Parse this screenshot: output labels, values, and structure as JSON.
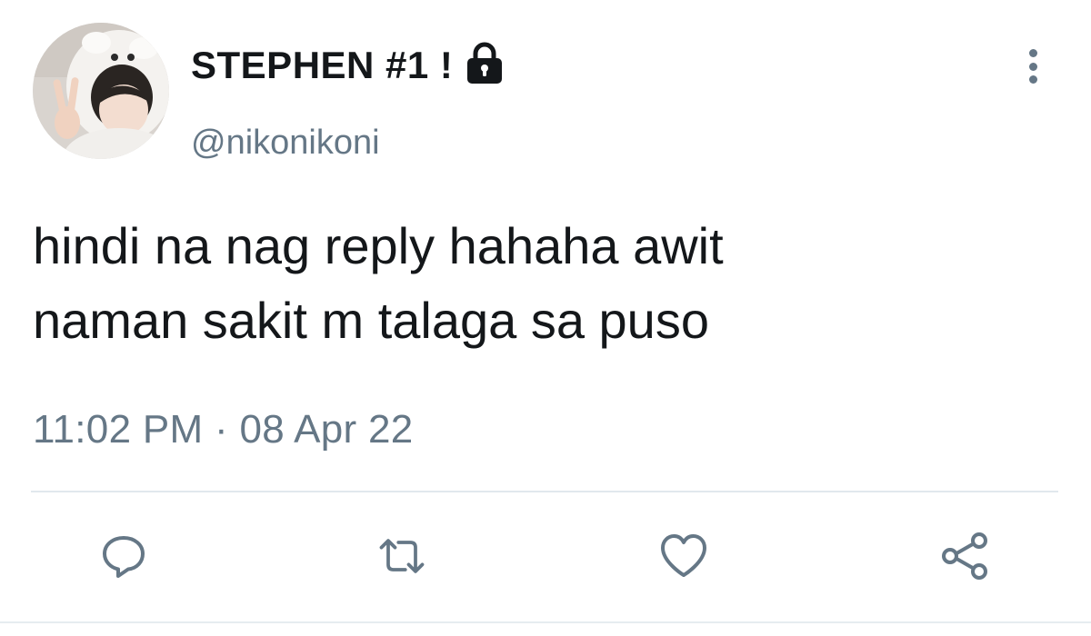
{
  "tweet": {
    "display_name": "STEPHEN #1 !",
    "handle": "@nikonikoni",
    "protected": true,
    "text": "hindi na nag reply hahaha awit\nnaman sakit m talaga sa puso",
    "timestamp": "11:02 PM · 08 Apr 22"
  },
  "icons": {
    "lock": "lock-icon",
    "more": "more-vertical-icon",
    "reply": "reply-icon",
    "retweet": "retweet-icon",
    "like": "heart-icon",
    "share": "share-icon"
  },
  "colors": {
    "text": "#14171a",
    "secondary": "#657786",
    "divider": "#e1e8ed",
    "background": "#ffffff"
  }
}
